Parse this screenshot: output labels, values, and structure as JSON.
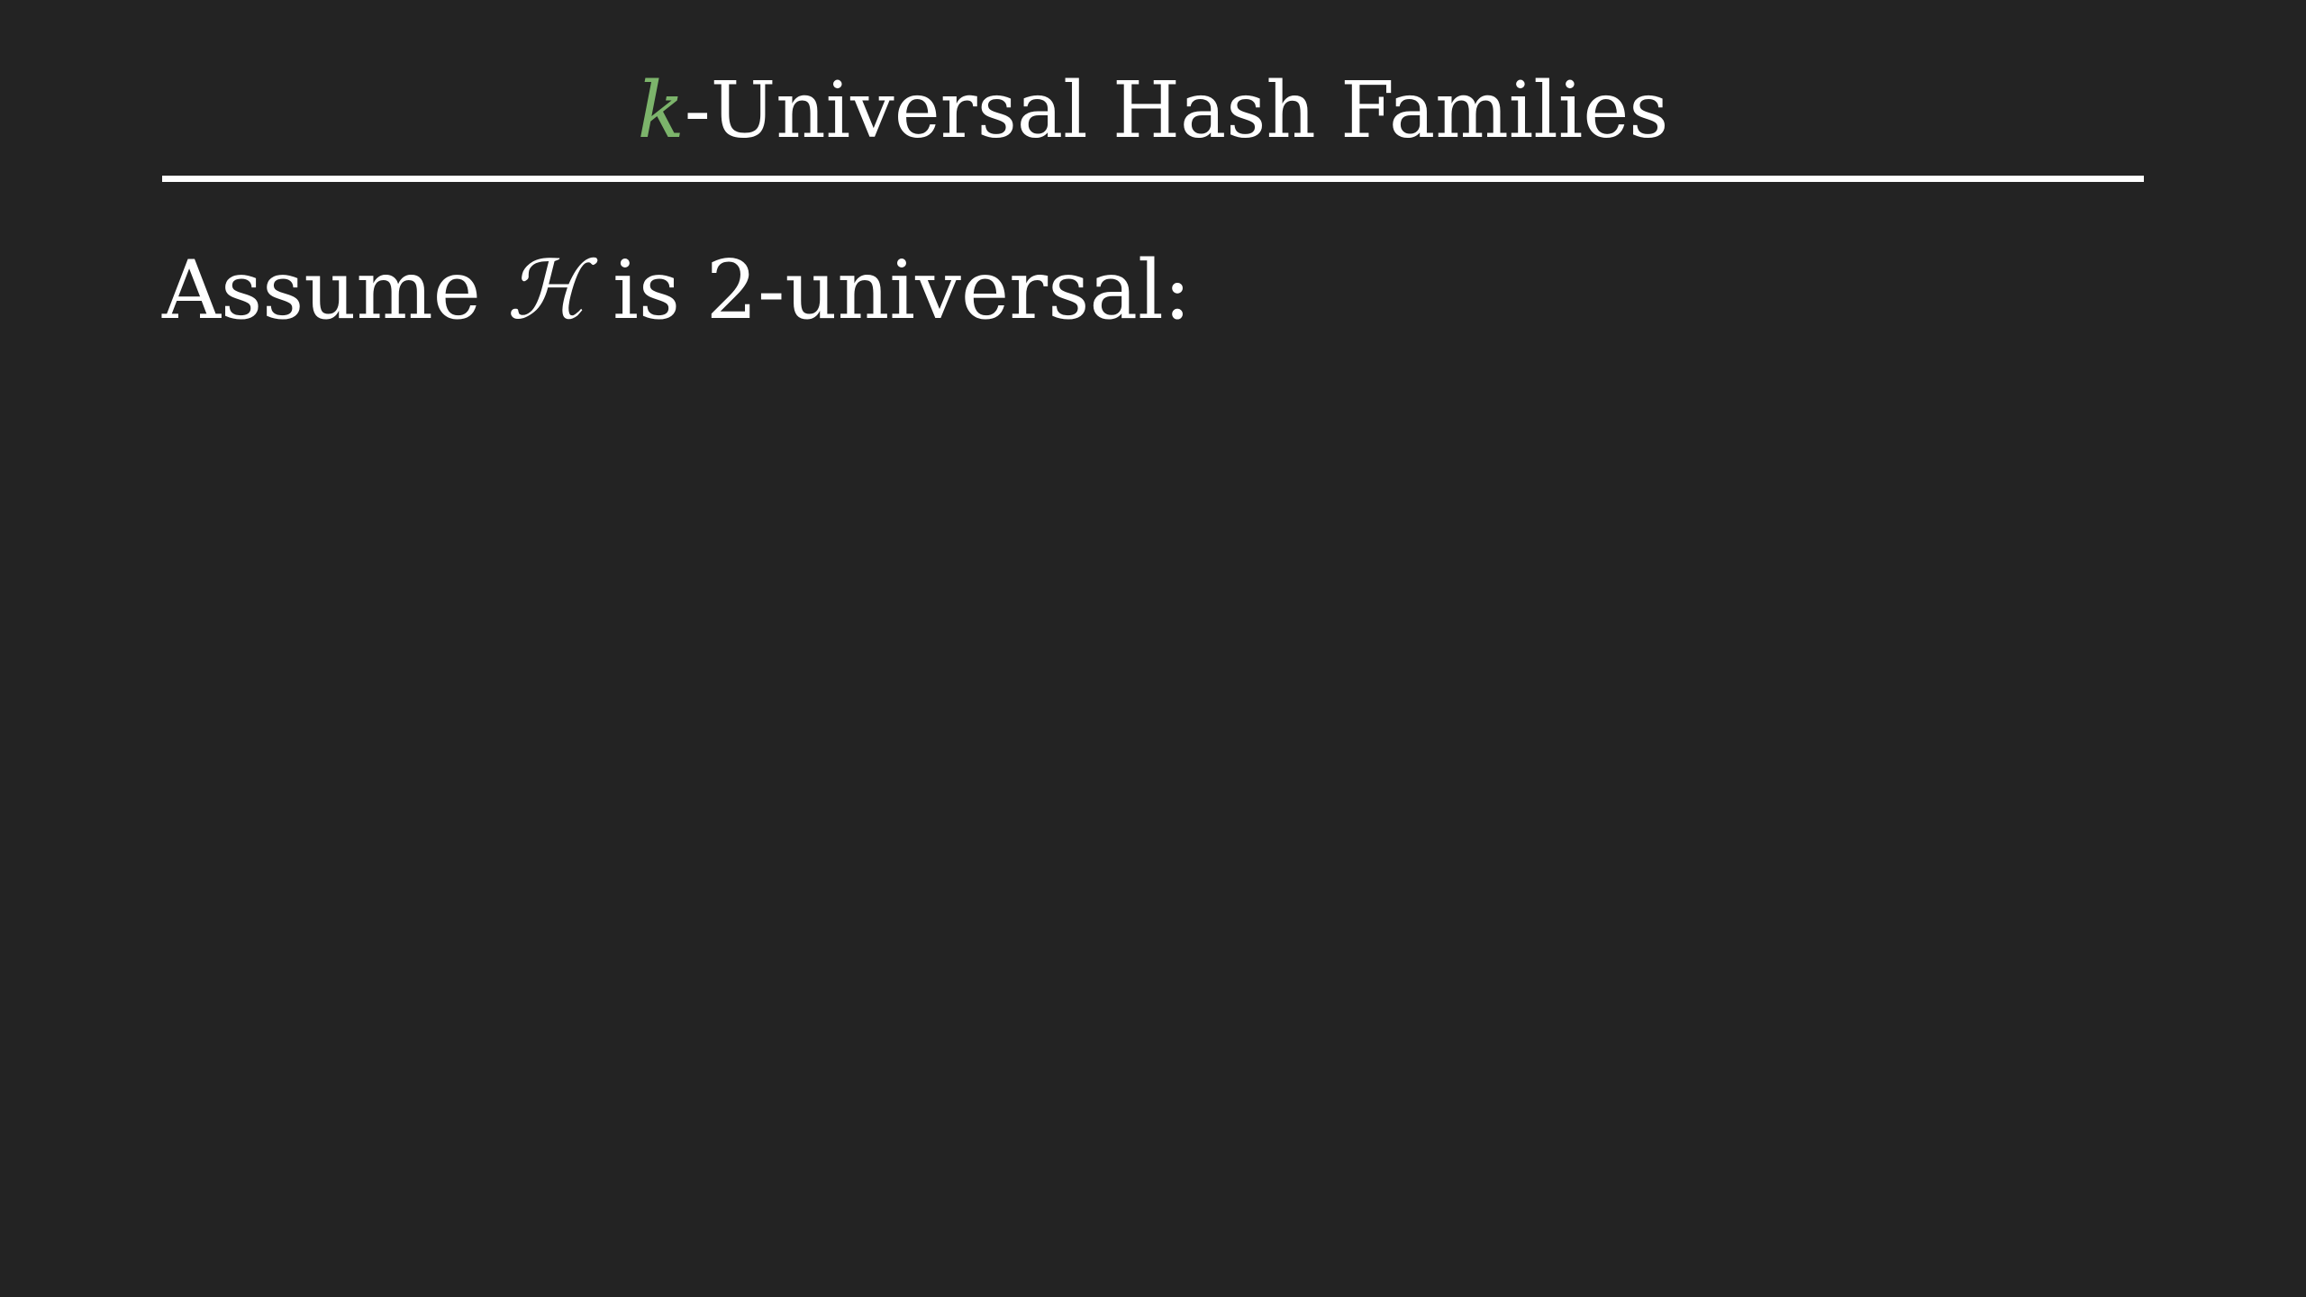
{
  "slide": {
    "title": {
      "variable": "k",
      "rest": "-Universal Hash Families"
    },
    "body": {
      "prefix": "Assume ",
      "symbol": "ℋ",
      "suffix": " is 2-universal:"
    }
  },
  "colors": {
    "background": "#232323",
    "text": "#ffffff",
    "accent_green": "#7cb46b"
  }
}
